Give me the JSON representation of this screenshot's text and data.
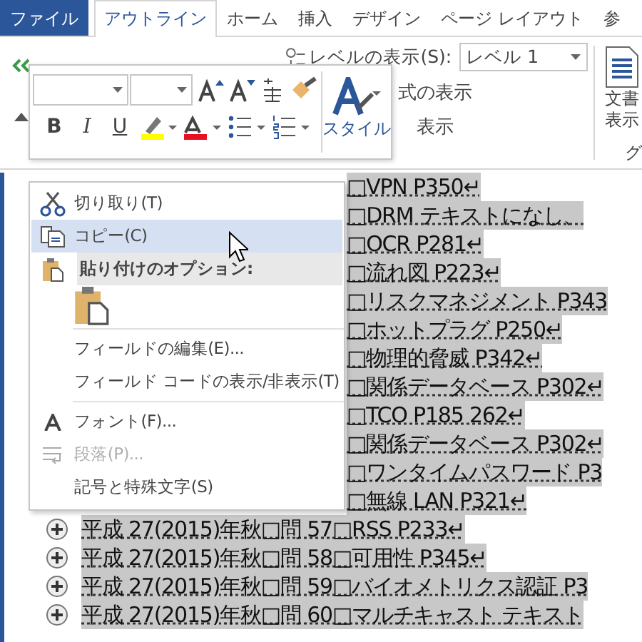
{
  "ribbon": {
    "tabs": [
      {
        "label": "ファイル",
        "kind": "file",
        "selected": false
      },
      {
        "label": "アウトライン",
        "kind": "tab",
        "selected": true
      },
      {
        "label": "ホーム",
        "kind": "tab",
        "selected": false
      },
      {
        "label": "挿入",
        "kind": "tab",
        "selected": false
      },
      {
        "label": "デザイン",
        "kind": "tab",
        "selected": false
      },
      {
        "label": "ページ レイアウト",
        "kind": "tab",
        "selected": false
      },
      {
        "label": "参",
        "kind": "tab",
        "selected": false
      }
    ],
    "show_level": {
      "label": "レベルの表示(S):",
      "value": "レベル 1"
    },
    "options": [
      "式の表示",
      "表示"
    ],
    "doc_button": [
      "文書",
      "表示"
    ],
    "group_label": "グ"
  },
  "mini_toolbar": {
    "format_buttons": [
      {
        "label": "B",
        "kind": "bold"
      },
      {
        "label": "I",
        "kind": "italic"
      },
      {
        "label": "U",
        "kind": "underline"
      }
    ],
    "style_label": "スタイル"
  },
  "outline": [
    {
      "text": "□VPN P350↵"
    },
    {
      "text": "□DRM テキストになし、"
    },
    {
      "text": "□OCR P281↵"
    },
    {
      "text": "□流れ図 P223↵"
    },
    {
      "text": "□リスクマネジメント P343"
    },
    {
      "text": "□ホットプラグ P250↵"
    },
    {
      "text": "□物理的脅威 P342↵"
    },
    {
      "text": "□関係データベース P302↵"
    },
    {
      "text": "□TCO P185 262↵"
    },
    {
      "text": "□関係データベース P302↵"
    },
    {
      "text": "□ワンタイムパスワード P3"
    },
    {
      "text": "□無線 LAN P321↵"
    },
    {
      "prefix": "平成 27(2015)年秋□問 57",
      "text": "□RSS P233↵"
    },
    {
      "prefix": "平成 27(2015)年秋□問 58",
      "text": "□可用性 P345↵"
    },
    {
      "prefix": "平成 27(2015)年秋□問 59",
      "text": "□バイオメトリクス認証 P3"
    },
    {
      "prefix": "平成 27(2015)年秋□問 60",
      "text": "□マルチキャスト テキスト"
    }
  ],
  "context_menu": [
    {
      "kind": "cut",
      "label": "切り取り(T)",
      "selected": false,
      "disabled": false
    },
    {
      "kind": "copy",
      "label": "コピー(C)",
      "selected": true,
      "disabled": false
    },
    {
      "kind": "header",
      "label": "貼り付けのオプション:"
    },
    {
      "kind": "paste"
    },
    {
      "kind": "separator"
    },
    {
      "kind": "plain",
      "label": "フィールドの編集(E)...",
      "selected": false,
      "disabled": false
    },
    {
      "kind": "plain",
      "label": "フィールド コードの表示/非表示(T)",
      "selected": false,
      "disabled": false
    },
    {
      "kind": "separator"
    },
    {
      "kind": "font",
      "label": "フォント(F)...",
      "selected": false,
      "disabled": false
    },
    {
      "kind": "paragraph",
      "label": "段落(P)...",
      "selected": false,
      "disabled": true
    },
    {
      "kind": "plain",
      "label": "記号と特殊文字(S)",
      "selected": false,
      "disabled": false
    }
  ]
}
